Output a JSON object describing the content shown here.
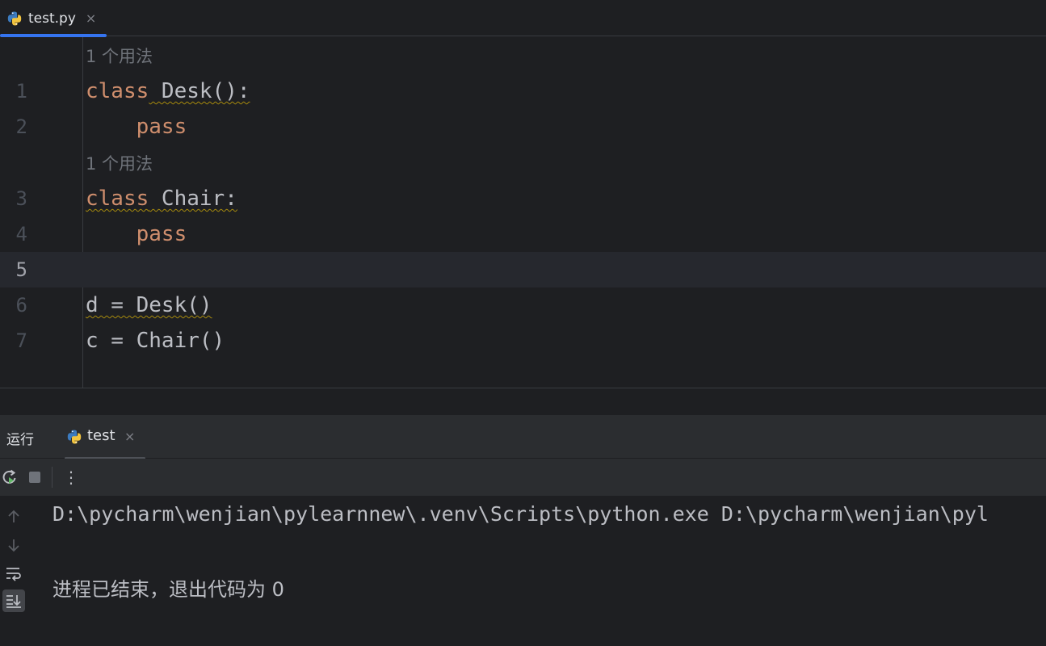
{
  "editor_tab": {
    "label": "test.py",
    "close": "×"
  },
  "editor": {
    "usage_hint": "1 个用法",
    "lines": [
      {
        "num": "1",
        "kw": "class",
        "rest": " Desk():"
      },
      {
        "num": "2",
        "indent": "    ",
        "kw": "pass"
      },
      {
        "num": "3",
        "kw": "class",
        "rest": " Chair:"
      },
      {
        "num": "4",
        "indent": "    ",
        "kw": "pass"
      },
      {
        "num": "5"
      },
      {
        "num": "6",
        "text": "d = Desk()"
      },
      {
        "num": "7",
        "text": "c = Chair()"
      }
    ]
  },
  "run": {
    "title": "运行",
    "tab_label": "test",
    "tab_close": "×",
    "more_label": "⋮",
    "console": [
      "D:\\pycharm\\wenjian\\pylearnnew\\.venv\\Scripts\\python.exe D:\\pycharm\\wenjian\\pyl",
      "进程已结束，退出代码为 0"
    ]
  },
  "colors": {
    "background": "#1e1f22",
    "keyword": "#cf8e6d",
    "accent": "#3574f0",
    "warning_squiggle": "#a68a0d"
  },
  "icons": [
    "python-icon",
    "close-icon",
    "rerun-icon",
    "stop-icon",
    "more-icon",
    "scroll-up-icon",
    "scroll-down-icon",
    "soft-wrap-icon",
    "scroll-to-end-icon"
  ]
}
